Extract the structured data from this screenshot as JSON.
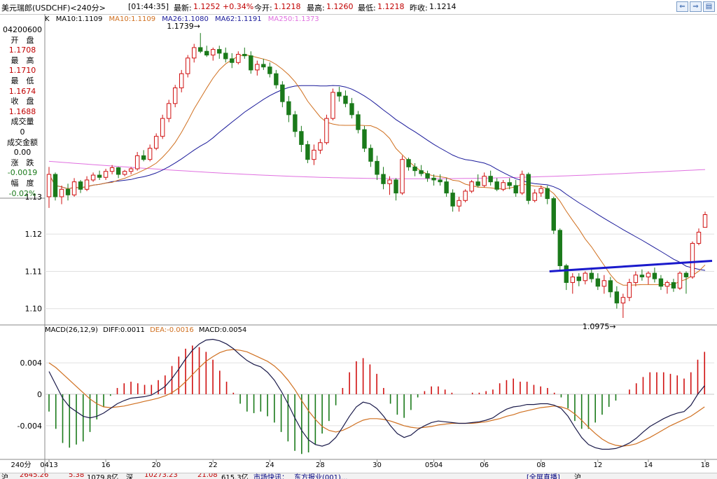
{
  "header": {
    "symbol": "美元瑞郎(USDCHF)<240分>",
    "time": "[01:44:35]",
    "latest_label": "最新:",
    "latest_value": "1.1252",
    "change": "+0.34%",
    "open_label": "今开:",
    "open_value": "1.1218",
    "high_label": "最高:",
    "high_value": "1.1260",
    "low_label": "最低:",
    "low_value": "1.1218",
    "prev_label": "昨收:",
    "prev_value": "1.1214",
    "nav_icons": [
      "back-icon",
      "forward-icon",
      "zoom-in-icon",
      "zoom-out-icon"
    ],
    "nav_glyphs": [
      "⇐",
      "⇒",
      "▤",
      "▥"
    ]
  },
  "ma_legend": {
    "k": "K",
    "items": [
      {
        "text": "MA10:1.1109",
        "color": "#000000"
      },
      {
        "text": "MA10:1.1109",
        "color": "#d07020"
      },
      {
        "text": "MA26:1.1080",
        "color": "#1a1a9a"
      },
      {
        "text": "MA62:1.1191",
        "color": "#1a1a9a"
      },
      {
        "text": "MA250:1.1373",
        "color": "#e070e0"
      }
    ]
  },
  "info_panel": [
    {
      "label": "04200600",
      "value": ""
    },
    {
      "label": "开　盘",
      "value": "1.1708"
    },
    {
      "label": "最　高",
      "value": "1.1710"
    },
    {
      "label": "最　低",
      "value": "1.1674"
    },
    {
      "label": "收　盘",
      "value": "1.1688"
    },
    {
      "label": "成交量",
      "value": "0"
    },
    {
      "label": "成交金额",
      "value": "0.00"
    },
    {
      "label": "涨　跌",
      "value": "-0.0019"
    },
    {
      "label": "幅　度",
      "value": "-0.02%"
    }
  ],
  "macd_legend": {
    "title": "MACD(26,12,9)",
    "items": [
      {
        "text": "DIFF:0.0011",
        "color": "#000000"
      },
      {
        "text": "DEA:-0.0016",
        "color": "#d07020"
      },
      {
        "text": "MACD:0.0054",
        "color": "#000000"
      }
    ]
  },
  "x_axis": {
    "period_label": "240分",
    "ticks": [
      "0413",
      "16",
      "20",
      "22",
      "24",
      "28",
      "30",
      "0504",
      "06",
      "08",
      "12",
      "14",
      "18"
    ]
  },
  "annotations": {
    "high_marker": "1.1739",
    "low_marker": "1.0975"
  },
  "bottom_bar": {
    "items": [
      "沪",
      "2645.26",
      "5.38",
      "1079.8亿",
      "深",
      "10273.23",
      "21.08",
      "615.3亿",
      "市场快讯：",
      "东方报业(001)...",
      "[全屏直播]",
      "沪"
    ]
  },
  "colors": {
    "up": "#d01010",
    "down": "#1a7a1a",
    "ma10": "#d07020",
    "ma26": "#1a1a9a",
    "ma250": "#e070e0",
    "trendline": "#1a1acc",
    "grid": "#e0e0e0"
  },
  "chart_data": [
    {
      "type": "candlestick",
      "title": "美元瑞郎(USDCHF)<240分>",
      "ylabel": "",
      "y_ticks": [
        1.1,
        1.11,
        1.12,
        1.13
      ],
      "ylim": [
        1.096,
        1.176
      ],
      "series": [
        {
          "name": "K",
          "ohlc": [
            [
              1.13,
              1.138,
              1.127,
              1.136
            ],
            [
              1.136,
              1.1365,
              1.129,
              1.13
            ],
            [
              1.13,
              1.133,
              1.128,
              1.132
            ],
            [
              1.132,
              1.1335,
              1.129,
              1.1305
            ],
            [
              1.1305,
              1.135,
              1.13,
              1.134
            ],
            [
              1.134,
              1.1345,
              1.131,
              1.132
            ],
            [
              1.132,
              1.1355,
              1.1315,
              1.1345
            ],
            [
              1.1345,
              1.1365,
              1.134,
              1.1358
            ],
            [
              1.1358,
              1.137,
              1.1345,
              1.1352
            ],
            [
              1.1352,
              1.1375,
              1.1345,
              1.1368
            ],
            [
              1.1368,
              1.1385,
              1.136,
              1.1378
            ],
            [
              1.1378,
              1.138,
              1.135,
              1.136
            ],
            [
              1.136,
              1.1372,
              1.1355,
              1.1368
            ],
            [
              1.1368,
              1.138,
              1.136,
              1.1375
            ],
            [
              1.1375,
              1.142,
              1.137,
              1.141
            ],
            [
              1.141,
              1.1425,
              1.1395,
              1.14
            ],
            [
              1.14,
              1.144,
              1.1395,
              1.143
            ],
            [
              1.143,
              1.147,
              1.1425,
              1.1462
            ],
            [
              1.1462,
              1.152,
              1.1455,
              1.151
            ],
            [
              1.151,
              1.156,
              1.15,
              1.155
            ],
            [
              1.155,
              1.16,
              1.154,
              1.1592
            ],
            [
              1.1592,
              1.164,
              1.158,
              1.163
            ],
            [
              1.163,
              1.168,
              1.162,
              1.1672
            ],
            [
              1.1672,
              1.171,
              1.166,
              1.17
            ],
            [
              1.17,
              1.1739,
              1.1685,
              1.169
            ],
            [
              1.169,
              1.1705,
              1.1675,
              1.168
            ],
            [
              1.168,
              1.17,
              1.1665,
              1.1695
            ],
            [
              1.1695,
              1.1705,
              1.167,
              1.1685
            ],
            [
              1.1685,
              1.17,
              1.166,
              1.167
            ],
            [
              1.167,
              1.1685,
              1.1645,
              1.166
            ],
            [
              1.166,
              1.169,
              1.1655,
              1.1682
            ],
            [
              1.1682,
              1.17,
              1.167,
              1.1678
            ],
            [
              1.1678,
              1.169,
              1.163,
              1.164
            ],
            [
              1.164,
              1.1665,
              1.1625,
              1.1655
            ],
            [
              1.1655,
              1.167,
              1.164,
              1.1648
            ],
            [
              1.1648,
              1.166,
              1.162,
              1.163
            ],
            [
              1.163,
              1.164,
              1.159,
              1.16
            ],
            [
              1.16,
              1.161,
              1.154,
              1.1555
            ],
            [
              1.1555,
              1.157,
              1.15,
              1.152
            ],
            [
              1.152,
              1.153,
              1.146,
              1.1475
            ],
            [
              1.1475,
              1.149,
              1.142,
              1.144
            ],
            [
              1.144,
              1.145,
              1.139,
              1.14
            ],
            [
              1.14,
              1.144,
              1.1385,
              1.1425
            ],
            [
              1.1425,
              1.1455,
              1.1415,
              1.1445
            ],
            [
              1.1445,
              1.152,
              1.144,
              1.151
            ],
            [
              1.151,
              1.159,
              1.1505,
              1.158
            ],
            [
              1.158,
              1.1595,
              1.1555,
              1.157
            ],
            [
              1.157,
              1.1585,
              1.154,
              1.155
            ],
            [
              1.155,
              1.1565,
              1.151,
              1.152
            ],
            [
              1.152,
              1.153,
              1.147,
              1.148
            ],
            [
              1.148,
              1.149,
              1.142,
              1.143
            ],
            [
              1.143,
              1.144,
              1.138,
              1.1395
            ],
            [
              1.1395,
              1.141,
              1.1345,
              1.136
            ],
            [
              1.136,
              1.138,
              1.132,
              1.1335
            ],
            [
              1.1335,
              1.1355,
              1.1305,
              1.1345
            ],
            [
              1.1345,
              1.135,
              1.129,
              1.131
            ],
            [
              1.131,
              1.141,
              1.1305,
              1.14
            ],
            [
              1.14,
              1.1405,
              1.137,
              1.138
            ],
            [
              1.138,
              1.139,
              1.1355,
              1.137
            ],
            [
              1.137,
              1.1385,
              1.1355,
              1.1362
            ],
            [
              1.1362,
              1.137,
              1.134,
              1.135
            ],
            [
              1.135,
              1.136,
              1.133,
              1.1345
            ],
            [
              1.1345,
              1.136,
              1.133,
              1.134
            ],
            [
              1.134,
              1.135,
              1.13,
              1.131
            ],
            [
              1.131,
              1.132,
              1.126,
              1.1275
            ],
            [
              1.1275,
              1.13,
              1.126,
              1.129
            ],
            [
              1.129,
              1.132,
              1.1285,
              1.1315
            ],
            [
              1.1315,
              1.1345,
              1.131,
              1.134
            ],
            [
              1.134,
              1.136,
              1.1325,
              1.133
            ],
            [
              1.133,
              1.1365,
              1.1325,
              1.1355
            ],
            [
              1.1355,
              1.137,
              1.133,
              1.134
            ],
            [
              1.134,
              1.135,
              1.1315,
              1.132
            ],
            [
              1.132,
              1.1345,
              1.1315,
              1.1338
            ],
            [
              1.1338,
              1.135,
              1.132,
              1.133
            ],
            [
              1.133,
              1.1345,
              1.13,
              1.131
            ],
            [
              1.131,
              1.137,
              1.1305,
              1.136
            ],
            [
              1.136,
              1.1365,
              1.128,
              1.129
            ],
            [
              1.129,
              1.132,
              1.1285,
              1.131
            ],
            [
              1.131,
              1.133,
              1.13,
              1.1322
            ],
            [
              1.1322,
              1.133,
              1.128,
              1.1295
            ],
            [
              1.1295,
              1.13,
              1.12,
              1.121
            ],
            [
              1.121,
              1.1215,
              1.11,
              1.1115
            ],
            [
              1.1115,
              1.112,
              1.105,
              1.107
            ],
            [
              1.107,
              1.1095,
              1.104,
              1.1085
            ],
            [
              1.1085,
              1.1095,
              1.106,
              1.1075
            ],
            [
              1.1075,
              1.11,
              1.1065,
              1.1095
            ],
            [
              1.1095,
              1.111,
              1.107,
              1.108
            ],
            [
              1.108,
              1.1095,
              1.105,
              1.106
            ],
            [
              1.106,
              1.109,
              1.104,
              1.1075
            ],
            [
              1.1075,
              1.1085,
              1.103,
              1.1045
            ],
            [
              1.1045,
              1.106,
              1.1,
              1.1015
            ],
            [
              1.1015,
              1.104,
              1.0975,
              1.103
            ],
            [
              1.103,
              1.108,
              1.102,
              1.107
            ],
            [
              1.107,
              1.11,
              1.106,
              1.109
            ],
            [
              1.109,
              1.1105,
              1.1075,
              1.1085
            ],
            [
              1.1085,
              1.11,
              1.1065,
              1.1095
            ],
            [
              1.1095,
              1.111,
              1.107,
              1.108
            ],
            [
              1.108,
              1.109,
              1.105,
              1.106
            ],
            [
              1.106,
              1.1075,
              1.104,
              1.107
            ],
            [
              1.107,
              1.108,
              1.1045,
              1.1055
            ],
            [
              1.1055,
              1.11,
              1.105,
              1.1095
            ],
            [
              1.1095,
              1.11,
              1.104,
              1.1085
            ],
            [
              1.1085,
              1.118,
              1.108,
              1.1175
            ],
            [
              1.1175,
              1.1215,
              1.117,
              1.1205
            ],
            [
              1.1218,
              1.126,
              1.1218,
              1.1252
            ]
          ]
        }
      ],
      "ma": {
        "MA10": 1.1109,
        "MA26": 1.108,
        "MA62": 1.1191,
        "MA250": 1.1373
      }
    },
    {
      "type": "bar",
      "title": "MACD(26,12,9)",
      "y_ticks": [
        0.004,
        0,
        -0.004
      ],
      "ylim": [
        -0.0082,
        0.0074
      ],
      "series": [
        {
          "name": "DIFF",
          "values": [
            0.0029,
            0.0012,
            -0.0005,
            -0.0016,
            -0.0022,
            -0.0028,
            -0.003,
            -0.0028,
            -0.0024,
            -0.0018,
            -0.0012,
            -0.0008,
            -0.0005,
            -0.0004,
            -0.0003,
            -0.0001,
            0.0004,
            0.001,
            0.002,
            0.0032,
            0.0045,
            0.0056,
            0.0064,
            0.0069,
            0.007,
            0.0068,
            0.0064,
            0.0058,
            0.005,
            0.0043,
            0.0038,
            0.0035,
            0.0028,
            0.0018,
            0.0004,
            -0.0012,
            -0.003,
            -0.0046,
            -0.0058,
            -0.0064,
            -0.0066,
            -0.0063,
            -0.0055,
            -0.0042,
            -0.0028,
            -0.0016,
            -0.001,
            -0.0012,
            -0.0018,
            -0.0028,
            -0.004,
            -0.005,
            -0.0055,
            -0.0052,
            -0.0045,
            -0.004,
            -0.0036,
            -0.0034,
            -0.0035,
            -0.0036,
            -0.0037,
            -0.0037,
            -0.0036,
            -0.0035,
            -0.0033,
            -0.003,
            -0.0024,
            -0.0019,
            -0.0016,
            -0.0015,
            -0.0013,
            -0.0013,
            -0.0012,
            -0.0012,
            -0.0014,
            -0.0018,
            -0.0028,
            -0.0042,
            -0.0055,
            -0.0064,
            -0.0068,
            -0.007,
            -0.007,
            -0.0069,
            -0.0066,
            -0.0062,
            -0.0056,
            -0.0048,
            -0.0041,
            -0.0036,
            -0.0031,
            -0.0027,
            -0.0024,
            -0.0022,
            -0.0014,
            0.0,
            0.0011
          ]
        },
        {
          "name": "DEA",
          "values": [
            0.004,
            0.0034,
            0.0026,
            0.0018,
            0.001,
            0.0002,
            -0.0006,
            -0.0012,
            -0.0016,
            -0.0017,
            -0.0016,
            -0.0015,
            -0.0013,
            -0.0011,
            -0.0009,
            -0.0007,
            -0.0005,
            -0.0002,
            0.0002,
            0.0008,
            0.0016,
            0.0025,
            0.0034,
            0.0042,
            0.0048,
            0.0053,
            0.0056,
            0.0057,
            0.0056,
            0.0054,
            0.005,
            0.0046,
            0.0042,
            0.0036,
            0.0028,
            0.0018,
            0.0006,
            -0.0008,
            -0.0021,
            -0.0032,
            -0.0041,
            -0.0046,
            -0.0048,
            -0.0046,
            -0.0042,
            -0.0037,
            -0.0033,
            -0.0031,
            -0.0031,
            -0.0032,
            -0.0034,
            -0.0037,
            -0.004,
            -0.0042,
            -0.0043,
            -0.0042,
            -0.0041,
            -0.0039,
            -0.0038,
            -0.0037,
            -0.0037,
            -0.0037,
            -0.0037,
            -0.0036,
            -0.0035,
            -0.0033,
            -0.0031,
            -0.0028,
            -0.0026,
            -0.0023,
            -0.0021,
            -0.0019,
            -0.0017,
            -0.0016,
            -0.0015,
            -0.0016,
            -0.0019,
            -0.0025,
            -0.0033,
            -0.0042,
            -0.005,
            -0.0057,
            -0.0062,
            -0.0065,
            -0.0066,
            -0.0065,
            -0.0063,
            -0.0059,
            -0.0055,
            -0.005,
            -0.0045,
            -0.004,
            -0.0036,
            -0.0032,
            -0.0028,
            -0.0022,
            -0.0016
          ]
        }
      ]
    }
  ]
}
